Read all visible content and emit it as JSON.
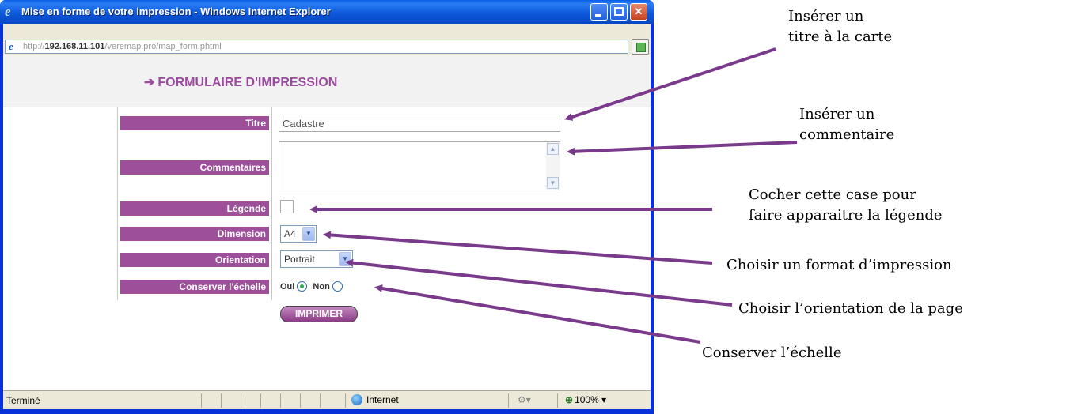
{
  "window": {
    "title": "Mise en forme de votre impression - Windows Internet Explorer",
    "url_prefix": "http://",
    "url_host": "192.168.11.101",
    "url_path": "/veremap.pro/map_form.phtml"
  },
  "form": {
    "heading": "FORMULAIRE D'IMPRESSION",
    "titre_label": "Titre",
    "titre_value": "Cadastre",
    "commentaires_label": "Commentaires",
    "legende_label": "Légende",
    "dimension_label": "Dimension",
    "dimension_value": "A4",
    "orientation_label": "Orientation",
    "orientation_value": "Portrait",
    "echelle_label": "Conserver l'échelle",
    "oui_label": "Oui",
    "non_label": "Non",
    "print_button": "IMPRIMER"
  },
  "statusbar": {
    "status": "Terminé",
    "zone": "Internet",
    "zoom": "100%"
  },
  "annotations": {
    "titre_line1": "Insérer un",
    "titre_line2": "titre à la carte",
    "comment_line1": "Insérer un",
    "comment_line2": "commentaire",
    "legende_line1": "Cocher cette case pour",
    "legende_line2": "faire apparaitre la légende",
    "format": "Choisir un format d’impression",
    "orientation": "Choisir l’orientation de la page",
    "echelle": "Conserver l’échelle"
  },
  "colors": {
    "accent": "#9d4f9a",
    "arrow": "#7a3a8c"
  }
}
